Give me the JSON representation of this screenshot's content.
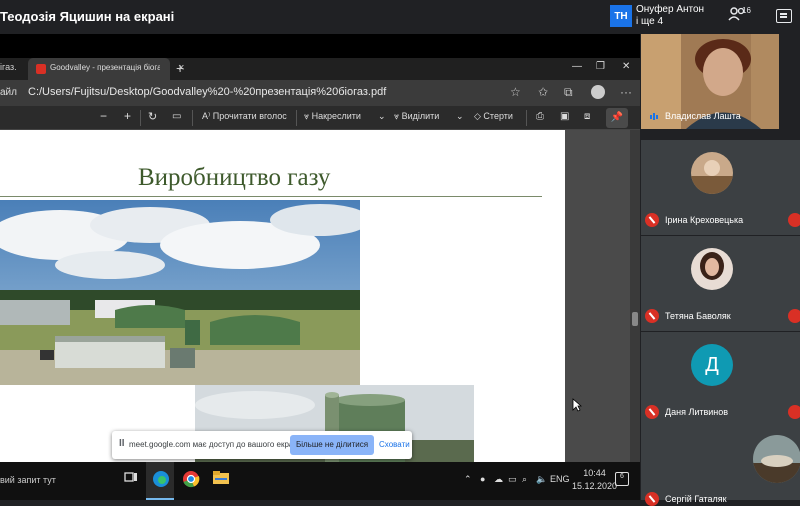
{
  "meet": {
    "presenting_title": "Теодозія Яцишин на екрані",
    "presenter_initials": "TH",
    "presenter_name_line1": "Онуфер Антон",
    "presenter_name_line2": "і ще 4",
    "people_count": "16"
  },
  "browser": {
    "prev_tab_label": "ігаз.",
    "active_tab_label": "Goodvalley - презентація біогаз.",
    "new_tab": "+",
    "address_prefix": "айл",
    "address_url": "C:/Users/Fujitsu/Desktop/Goodvalley%20-%20презентація%20біогаз.pdf"
  },
  "pdf_toolbar": {
    "read_aloud": "Прочитати вголос",
    "draw": "Накреслити",
    "highlight": "Виділити",
    "erase": "Стерти"
  },
  "slide": {
    "title": "Виробництво газу"
  },
  "share_toast": {
    "text": "meet.google.com має доступ до вашого екрана.",
    "stop_label": "Більше не ділитися",
    "hide_label": "Сховати"
  },
  "taskbar": {
    "search_text": "вий запит тут",
    "lang": "ENG",
    "time": "10:44",
    "date": "15.12.2020",
    "notif_count": "6"
  },
  "participants": {
    "self_name": "Владислав Лашта",
    "list": [
      {
        "name": "Ірина Креховецька"
      },
      {
        "name": "Тетяна Баволяк"
      },
      {
        "name": "Даня Литвинов",
        "initial": "Д"
      },
      {
        "name": "Сергій Гаталяк"
      }
    ]
  },
  "colors": {
    "accent_blue": "#8ab4f8",
    "mic_off_red": "#d93025",
    "slide_title_green": "#3e5a2c",
    "avatar_teal": "#0f9ab3"
  }
}
